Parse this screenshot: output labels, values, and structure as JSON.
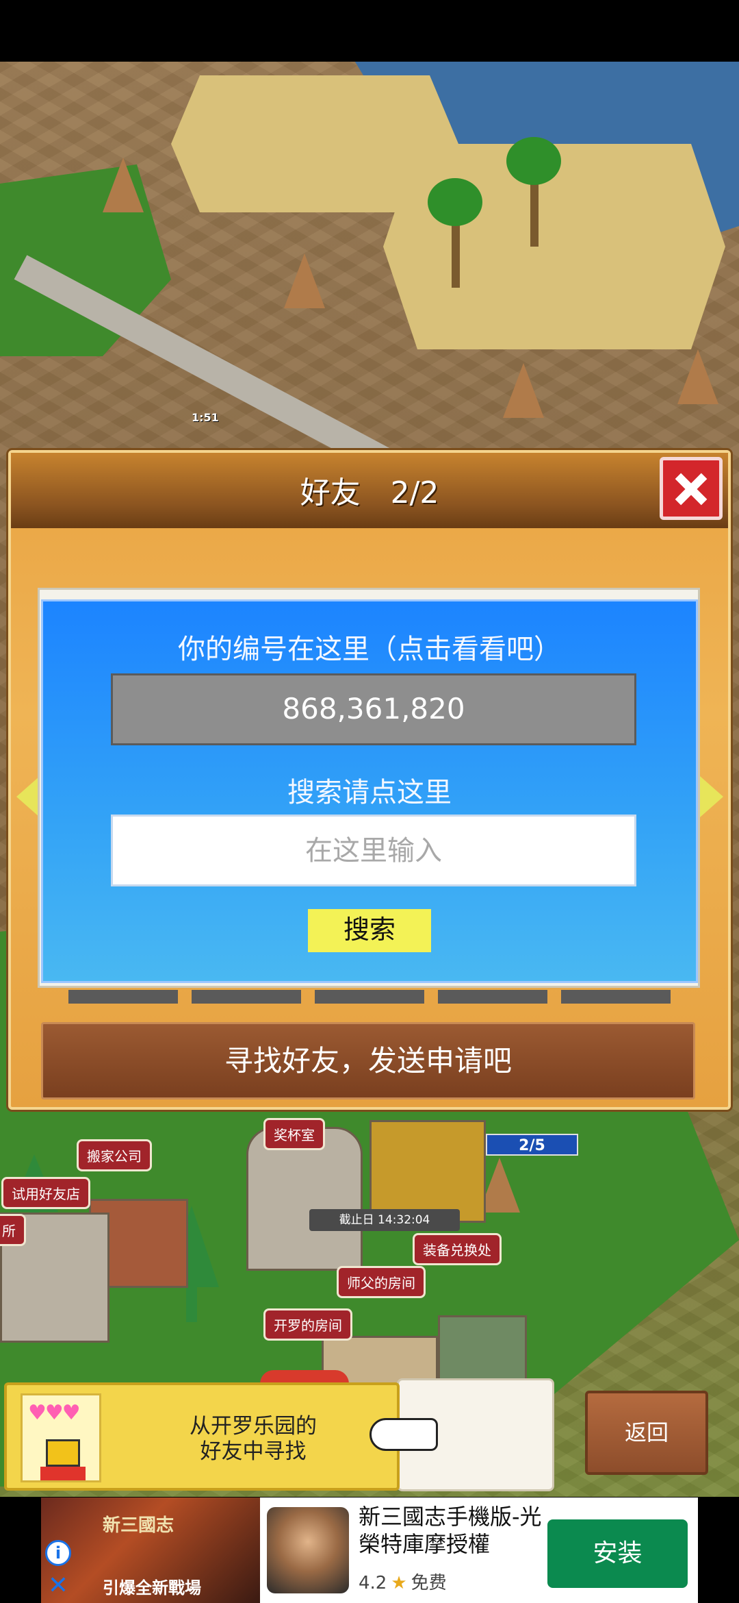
{
  "dialog": {
    "title": "好友　2/2",
    "id_prompt": "你的编号在这里（点击看看吧）",
    "player_id": "868,361,820",
    "search_prompt": "搜索请点这里",
    "search_placeholder": "在这里输入",
    "search_button": "搜索",
    "find_button": "寻找好友，发送申请吧"
  },
  "map": {
    "player_timer": "1:51",
    "labels": {
      "trophy_room": "奖杯室",
      "moving_company": "搬家公司",
      "trial_friend_shop": "试用好友店",
      "partial_left": "所",
      "equipment_exchange": "装备兑换处",
      "master_room": "师父的房间",
      "kairo_room": "开罗的房间"
    },
    "deadline": "截止日 14:32:04",
    "counter": "2/5"
  },
  "bottom": {
    "kairo_line1": "从开罗乐园的",
    "kairo_line2": "好友中寻找",
    "hearts": "♥♥♥",
    "back_button": "返回"
  },
  "ad": {
    "image_title": "新三國志",
    "image_subtitle": "引爆全新戰場",
    "title": "新三國志手機版-光榮特庫摩授權",
    "rating": "4.2",
    "price": "免费",
    "install_button": "安装",
    "info_icon": "info-icon",
    "close_icon": "close-icon"
  },
  "colors": {
    "dialog_bg": "#efb455",
    "panel_blue": "#1c84ff",
    "close_red": "#d3262b",
    "search_yellow": "#f3f256",
    "install_green": "#0b8a4f"
  }
}
